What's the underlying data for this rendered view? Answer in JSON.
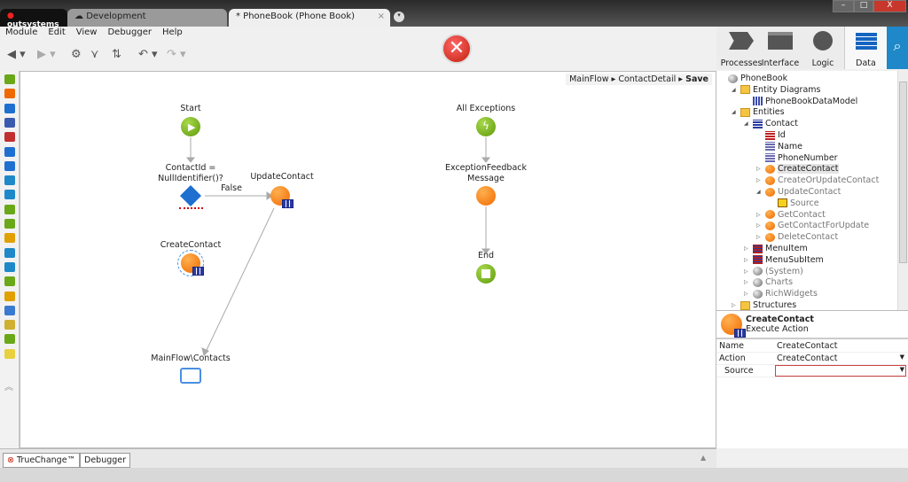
{
  "window": {
    "brand": "outsystems",
    "tabs": [
      "Development",
      "* PhoneBook (Phone Book)"
    ],
    "close_tab": "×",
    "minimize": "–",
    "maximize": "□",
    "close": "X"
  },
  "menu": [
    "Module",
    "Edit",
    "View",
    "Debugger",
    "Help"
  ],
  "layers": [
    {
      "label": "Processes"
    },
    {
      "label": "Interface"
    },
    {
      "label": "Logic"
    },
    {
      "label": "Data",
      "active": true
    }
  ],
  "breadcrumb": {
    "items": [
      "MainFlow",
      "ContactDetail"
    ],
    "current": "Save",
    "sep": "▸"
  },
  "flow": {
    "start": "Start",
    "if_cond": "ContactId =\nNullIdentifier()?",
    "false_label": "False",
    "update": "UpdateContact",
    "create": "CreateContact",
    "destination": "MainFlow\\Contacts",
    "all_exceptions": "All Exceptions",
    "exception_feedback": "ExceptionFeedback\nMessage",
    "end": "End"
  },
  "tree": [
    {
      "label": "PhoneBook",
      "indent": 0,
      "icon": "module",
      "exp": ""
    },
    {
      "label": "Entity Diagrams",
      "indent": 1,
      "icon": "folder",
      "exp": "◢"
    },
    {
      "label": "PhoneBookDataModel",
      "indent": 2,
      "icon": "diagram",
      "exp": ""
    },
    {
      "label": "Entities",
      "indent": 1,
      "icon": "folder",
      "exp": "◢"
    },
    {
      "label": "Contact",
      "indent": 2,
      "icon": "entity",
      "exp": "◢"
    },
    {
      "label": "Id",
      "indent": 3,
      "icon": "attr-key",
      "exp": ""
    },
    {
      "label": "Name",
      "indent": 3,
      "icon": "attr",
      "exp": ""
    },
    {
      "label": "PhoneNumber",
      "indent": 3,
      "icon": "attr",
      "exp": ""
    },
    {
      "label": "CreateContact",
      "indent": 3,
      "icon": "action",
      "exp": "▷",
      "selected": true
    },
    {
      "label": "CreateOrUpdateContact",
      "indent": 3,
      "icon": "action",
      "exp": "▷",
      "grey": true
    },
    {
      "label": "UpdateContact",
      "indent": 3,
      "icon": "action",
      "exp": "◢",
      "grey": true
    },
    {
      "label": "Source",
      "indent": 4,
      "icon": "input-param",
      "exp": "",
      "grey": true
    },
    {
      "label": "GetContact",
      "indent": 3,
      "icon": "action",
      "exp": "▷",
      "grey": true
    },
    {
      "label": "GetContactForUpdate",
      "indent": 3,
      "icon": "action",
      "exp": "▷",
      "grey": true
    },
    {
      "label": "DeleteContact",
      "indent": 3,
      "icon": "action",
      "exp": "▷",
      "grey": true
    },
    {
      "label": "MenuItem",
      "indent": 2,
      "icon": "entity-red",
      "exp": "▷"
    },
    {
      "label": "MenuSubItem",
      "indent": 2,
      "icon": "entity-red",
      "exp": "▷"
    },
    {
      "label": "(System)",
      "indent": 2,
      "icon": "module",
      "exp": "▷",
      "grey": true
    },
    {
      "label": "Charts",
      "indent": 2,
      "icon": "module",
      "exp": "▷",
      "grey": true
    },
    {
      "label": "RichWidgets",
      "indent": 2,
      "icon": "module",
      "exp": "▷",
      "grey": true
    },
    {
      "label": "Structures",
      "indent": 1,
      "icon": "folder",
      "exp": "▷"
    }
  ],
  "properties": {
    "title": "CreateContact",
    "subtitle": "Execute Action",
    "rows": [
      {
        "name": "Name",
        "value": "CreateContact"
      },
      {
        "name": "Action",
        "value": "CreateContact",
        "dropdown": true
      },
      {
        "name": "Source",
        "value": "",
        "dropdown": true,
        "error": true
      }
    ]
  },
  "bottom_tabs": [
    "TrueChange™",
    "Debugger"
  ],
  "colors": {
    "accent": "#1e88c8",
    "error": "#c1200c",
    "orange": "#ef6a00",
    "green": "#6aa81a"
  }
}
